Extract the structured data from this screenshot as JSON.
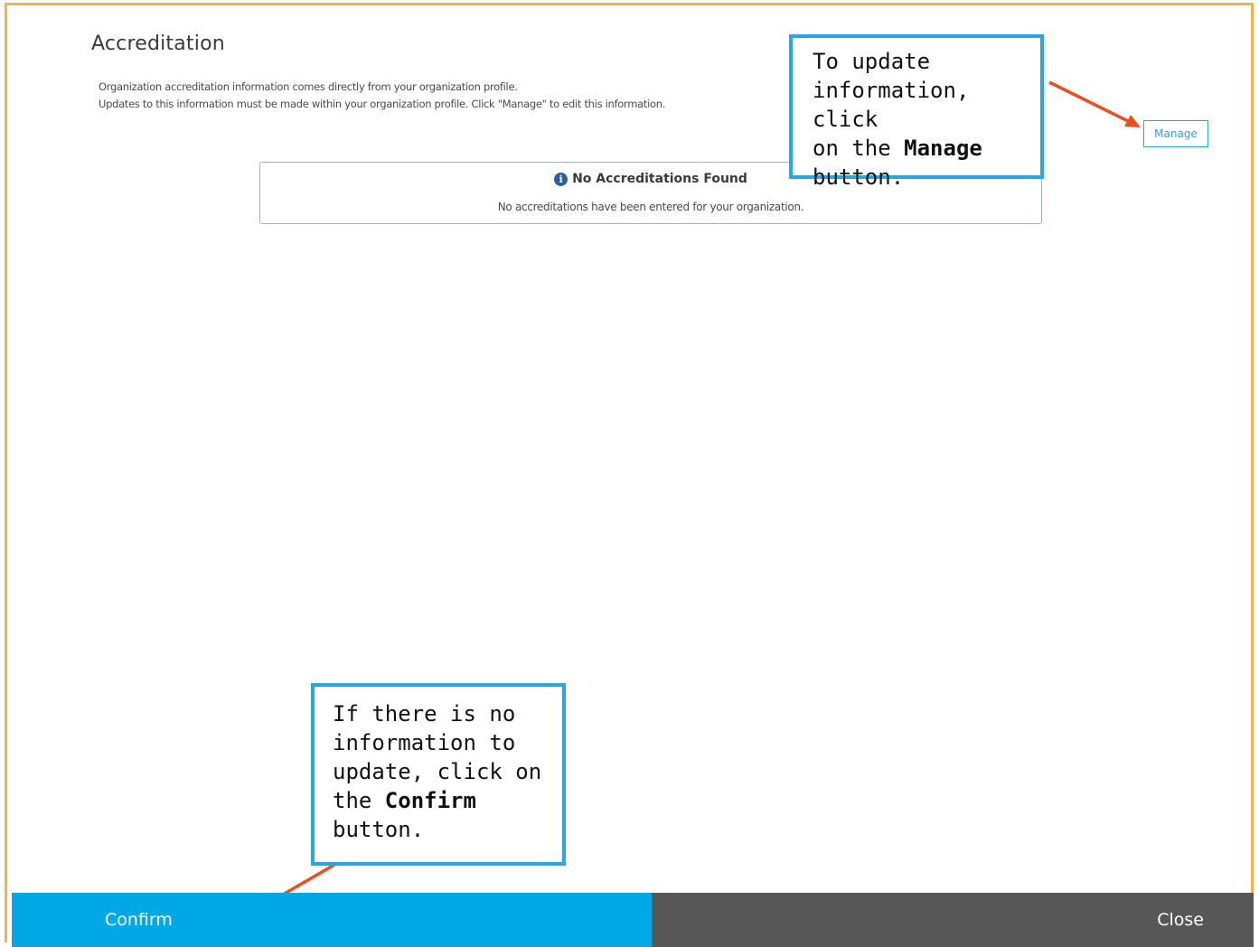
{
  "page": {
    "title": "Accreditation",
    "description_line1": "Organization accreditation information comes directly from your organization profile.",
    "description_line2": "Updates to this information must be made within your organization profile. Click \"Manage\" to edit this information."
  },
  "manage_button": {
    "label": "Manage"
  },
  "empty_state": {
    "icon": "info-icon",
    "title": "No Accreditations Found",
    "message": "No accreditations have been entered for your organization."
  },
  "callouts": {
    "manage": {
      "line1": "To update",
      "line2": "information, click",
      "line3_prefix": "on the ",
      "line3_bold": "Manage",
      "line4": "button."
    },
    "confirm": {
      "line1": "If there is no",
      "line2": "information to",
      "line3": "update, click on",
      "line4_prefix": "the ",
      "line4_bold": "Confirm",
      "line5": "button."
    }
  },
  "footer": {
    "confirm_label": "Confirm",
    "close_label": "Close"
  },
  "colors": {
    "frame_border": "#f4b24f",
    "accent_blue": "#00a8e6",
    "callout_border": "#2aa6df",
    "arrow": "#e8501c",
    "close_bg": "#575757"
  }
}
